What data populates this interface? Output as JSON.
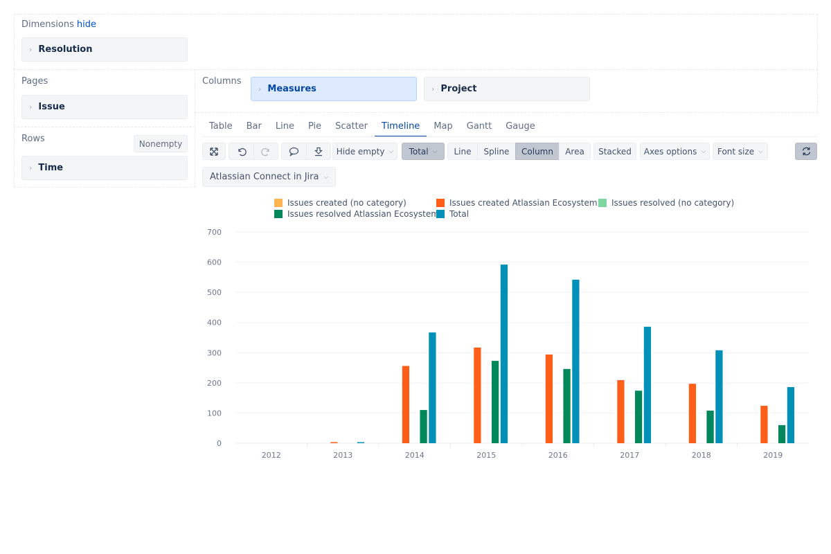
{
  "dimensions": {
    "title": "Dimensions",
    "hide_link": "hide",
    "items": [
      {
        "label": "Resolution"
      }
    ]
  },
  "pages": {
    "title": "Pages",
    "items": [
      {
        "label": "Issue"
      }
    ]
  },
  "rows": {
    "title": "Rows",
    "nonempty_label": "Nonempty",
    "items": [
      {
        "label": "Time"
      }
    ]
  },
  "columns": {
    "title": "Columns",
    "items": [
      {
        "label": "Measures",
        "active": true
      },
      {
        "label": "Project"
      }
    ]
  },
  "view_tabs": {
    "items": [
      "Table",
      "Bar",
      "Line",
      "Pie",
      "Scatter",
      "Timeline",
      "Map",
      "Gantt",
      "Gauge"
    ],
    "active": "Timeline"
  },
  "toolbar": {
    "fullscreen_icon": "expand-arrows-icon",
    "undo_icon": "undo-icon",
    "redo_icon": "redo-icon",
    "comment_icon": "speech-bubble-icon",
    "export_icon": "download-icon",
    "hide_empty_label": "Hide empty",
    "total_label": "Total",
    "chart_types": [
      "Line",
      "Spline",
      "Column",
      "Area"
    ],
    "active_chart_type": "Column",
    "stacked_label": "Stacked",
    "axes_options_label": "Axes options",
    "font_size_label": "Font size",
    "refresh_icon": "refresh-icon"
  },
  "page_filter": {
    "selected": "Atlassian Connect in Jira"
  },
  "chart_data": {
    "type": "bar",
    "title": "",
    "xlabel": "",
    "ylabel": "",
    "ylim": [
      0,
      700
    ],
    "yticks": [
      0,
      100,
      200,
      300,
      400,
      500,
      600,
      700
    ],
    "grid": true,
    "legend_position": "top",
    "categories": [
      "2012",
      "2013",
      "2014",
      "2015",
      "2016",
      "2017",
      "2018",
      "2019"
    ],
    "series": [
      {
        "name": "Issues created (no category)",
        "color": "#ffb553",
        "values": [
          0,
          0,
          0,
          0,
          0,
          0,
          0,
          0
        ]
      },
      {
        "name": "Issues created Atlassian Ecosystem",
        "color": "#ff5e19",
        "values": [
          0,
          3,
          256,
          317,
          294,
          209,
          197,
          124
        ]
      },
      {
        "name": "Issues resolved (no category)",
        "color": "#7fd6a3",
        "values": [
          0,
          0,
          0,
          0,
          0,
          0,
          0,
          0
        ]
      },
      {
        "name": "Issues resolved Atlassian Ecosystem",
        "color": "#00875a",
        "values": [
          0,
          0,
          110,
          273,
          246,
          174,
          108,
          60
        ]
      },
      {
        "name": "Total",
        "color": "#0090b8",
        "values": [
          0,
          3,
          367,
          592,
          542,
          386,
          308,
          186
        ]
      }
    ]
  }
}
